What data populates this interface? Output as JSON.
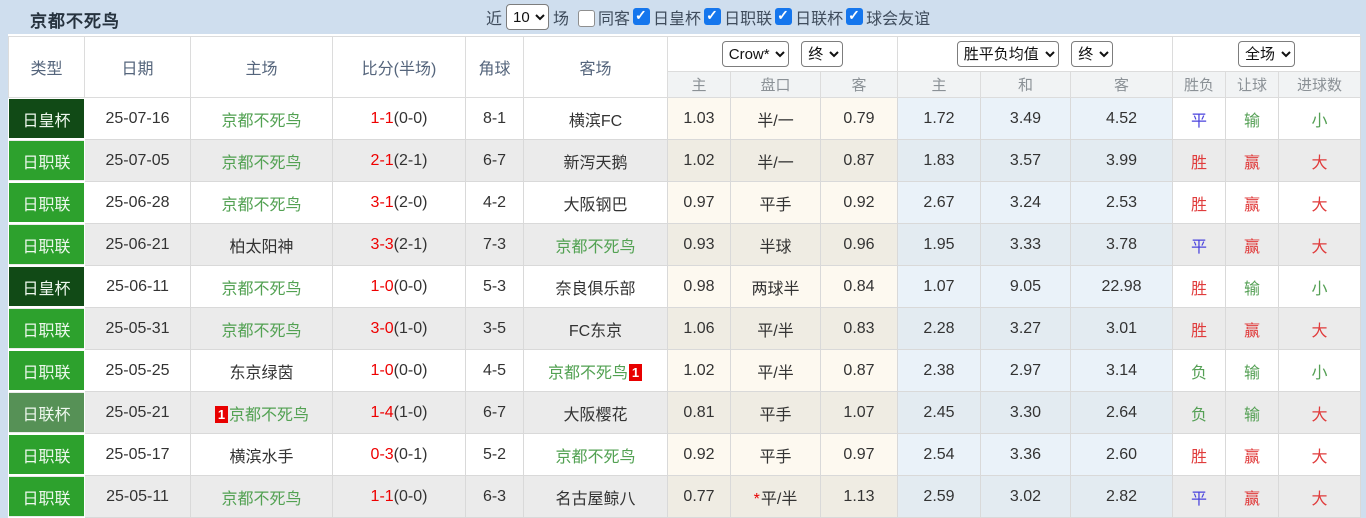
{
  "app": {
    "title": "京都不死鸟"
  },
  "topbar": {
    "recent_label": "近",
    "recent_count": "10",
    "unit_label": "场",
    "same_venue": {
      "label": "同客",
      "checked": false
    },
    "filters": [
      {
        "label": "日皇杯",
        "checked": true
      },
      {
        "label": "日职联",
        "checked": true
      },
      {
        "label": "日联杯",
        "checked": true
      },
      {
        "label": "球会友谊",
        "checked": true
      }
    ]
  },
  "table": {
    "main_headers": [
      "类型",
      "日期",
      "主场",
      "比分(半场)",
      "角球",
      "客场"
    ],
    "selectors": {
      "bookmaker": "Crow*",
      "bookmaker_time": "终",
      "average": "胜平负均值",
      "average_time": "终",
      "scope": "全场"
    },
    "sub_headers": [
      "主",
      "盘口",
      "客",
      "主",
      "和",
      "客",
      "胜负",
      "让球",
      "进球数"
    ]
  },
  "colors": {
    "--type-emperor": "#114a16",
    "--type-league": "#2da12d",
    "--type-leaguecup": "#569156",
    "--self-team": "#52a152",
    "--score-red": "#ee0000",
    "--result-win": "#e03c3c",
    "--result-draw": "#4a43dd",
    "--result-lose": "#55a055",
    "--checkbox-blue": "#1576ed"
  },
  "rows": [
    {
      "type": "日皇杯",
      "type_style": "emperor",
      "date": "25-07-16",
      "home": {
        "name": "京都不死鸟",
        "self": true
      },
      "score_ft": "1-1",
      "score_ht": "(0-0)",
      "corners": "8-1",
      "away": {
        "name": "横滨FC",
        "self": false
      },
      "crow": [
        "1.03",
        "半/一",
        "0.79"
      ],
      "crow_star": false,
      "avg": [
        "1.72",
        "3.49",
        "4.52"
      ],
      "result": {
        "text": "平",
        "style": "draw"
      },
      "handicap": {
        "text": "输",
        "style": "lose"
      },
      "goals": {
        "text": "小",
        "style": "lose"
      }
    },
    {
      "type": "日职联",
      "type_style": "league",
      "date": "25-07-05",
      "home": {
        "name": "京都不死鸟",
        "self": true
      },
      "score_ft": "2-1",
      "score_ht": "(2-1)",
      "corners": "6-7",
      "away": {
        "name": "新泻天鹅",
        "self": false
      },
      "crow": [
        "1.02",
        "半/一",
        "0.87"
      ],
      "crow_star": false,
      "avg": [
        "1.83",
        "3.57",
        "3.99"
      ],
      "result": {
        "text": "胜",
        "style": "win"
      },
      "handicap": {
        "text": "赢",
        "style": "win"
      },
      "goals": {
        "text": "大",
        "style": "win"
      }
    },
    {
      "type": "日职联",
      "type_style": "league",
      "date": "25-06-28",
      "home": {
        "name": "京都不死鸟",
        "self": true
      },
      "score_ft": "3-1",
      "score_ht": "(2-0)",
      "corners": "4-2",
      "away": {
        "name": "大阪钢巴",
        "self": false
      },
      "crow": [
        "0.97",
        "平手",
        "0.92"
      ],
      "crow_star": false,
      "avg": [
        "2.67",
        "3.24",
        "2.53"
      ],
      "result": {
        "text": "胜",
        "style": "win"
      },
      "handicap": {
        "text": "赢",
        "style": "win"
      },
      "goals": {
        "text": "大",
        "style": "win"
      }
    },
    {
      "type": "日职联",
      "type_style": "league",
      "date": "25-06-21",
      "home": {
        "name": "柏太阳神",
        "self": false
      },
      "score_ft": "3-3",
      "score_ht": "(2-1)",
      "corners": "7-3",
      "away": {
        "name": "京都不死鸟",
        "self": true
      },
      "crow": [
        "0.93",
        "半球",
        "0.96"
      ],
      "crow_star": false,
      "avg": [
        "1.95",
        "3.33",
        "3.78"
      ],
      "result": {
        "text": "平",
        "style": "draw"
      },
      "handicap": {
        "text": "赢",
        "style": "win"
      },
      "goals": {
        "text": "大",
        "style": "win"
      }
    },
    {
      "type": "日皇杯",
      "type_style": "emperor",
      "date": "25-06-11",
      "home": {
        "name": "京都不死鸟",
        "self": true
      },
      "score_ft": "1-0",
      "score_ht": "(0-0)",
      "corners": "5-3",
      "away": {
        "name": "奈良俱乐部",
        "self": false
      },
      "crow": [
        "0.98",
        "两球半",
        "0.84"
      ],
      "crow_star": false,
      "avg": [
        "1.07",
        "9.05",
        "22.98"
      ],
      "result": {
        "text": "胜",
        "style": "win"
      },
      "handicap": {
        "text": "输",
        "style": "lose"
      },
      "goals": {
        "text": "小",
        "style": "lose"
      }
    },
    {
      "type": "日职联",
      "type_style": "league",
      "date": "25-05-31",
      "home": {
        "name": "京都不死鸟",
        "self": true
      },
      "score_ft": "3-0",
      "score_ht": "(1-0)",
      "corners": "3-5",
      "away": {
        "name": "FC东京",
        "self": false
      },
      "crow": [
        "1.06",
        "平/半",
        "0.83"
      ],
      "crow_star": false,
      "avg": [
        "2.28",
        "3.27",
        "3.01"
      ],
      "result": {
        "text": "胜",
        "style": "win"
      },
      "handicap": {
        "text": "赢",
        "style": "win"
      },
      "goals": {
        "text": "大",
        "style": "win"
      }
    },
    {
      "type": "日职联",
      "type_style": "league",
      "date": "25-05-25",
      "home": {
        "name": "东京绿茵",
        "self": false
      },
      "score_ft": "1-0",
      "score_ht": "(0-0)",
      "corners": "4-5",
      "away": {
        "name": "京都不死鸟",
        "self": true,
        "card": "1",
        "card_pos": "after"
      },
      "crow": [
        "1.02",
        "平/半",
        "0.87"
      ],
      "crow_star": false,
      "avg": [
        "2.38",
        "2.97",
        "3.14"
      ],
      "result": {
        "text": "负",
        "style": "lose"
      },
      "handicap": {
        "text": "输",
        "style": "lose"
      },
      "goals": {
        "text": "小",
        "style": "lose"
      }
    },
    {
      "type": "日联杯",
      "type_style": "leaguecup",
      "date": "25-05-21",
      "home": {
        "name": "京都不死鸟",
        "self": true,
        "card": "1",
        "card_pos": "before"
      },
      "score_ft": "1-4",
      "score_ht": "(1-0)",
      "corners": "6-7",
      "away": {
        "name": "大阪樱花",
        "self": false
      },
      "crow": [
        "0.81",
        "平手",
        "1.07"
      ],
      "crow_star": false,
      "avg": [
        "2.45",
        "3.30",
        "2.64"
      ],
      "result": {
        "text": "负",
        "style": "lose"
      },
      "handicap": {
        "text": "输",
        "style": "lose"
      },
      "goals": {
        "text": "大",
        "style": "win"
      }
    },
    {
      "type": "日职联",
      "type_style": "league",
      "date": "25-05-17",
      "home": {
        "name": "横滨水手",
        "self": false
      },
      "score_ft": "0-3",
      "score_ht": "(0-1)",
      "corners": "5-2",
      "away": {
        "name": "京都不死鸟",
        "self": true
      },
      "crow": [
        "0.92",
        "平手",
        "0.97"
      ],
      "crow_star": false,
      "avg": [
        "2.54",
        "3.36",
        "2.60"
      ],
      "result": {
        "text": "胜",
        "style": "win"
      },
      "handicap": {
        "text": "赢",
        "style": "win"
      },
      "goals": {
        "text": "大",
        "style": "win"
      }
    },
    {
      "type": "日职联",
      "type_style": "league",
      "date": "25-05-11",
      "home": {
        "name": "京都不死鸟",
        "self": true
      },
      "score_ft": "1-1",
      "score_ht": "(0-0)",
      "corners": "6-3",
      "away": {
        "name": "名古屋鲸八",
        "self": false
      },
      "crow": [
        "0.77",
        "平/半",
        "1.13"
      ],
      "crow_star": true,
      "avg": [
        "2.59",
        "3.02",
        "2.82"
      ],
      "result": {
        "text": "平",
        "style": "draw"
      },
      "handicap": {
        "text": "赢",
        "style": "win"
      },
      "goals": {
        "text": "大",
        "style": "win"
      }
    }
  ]
}
